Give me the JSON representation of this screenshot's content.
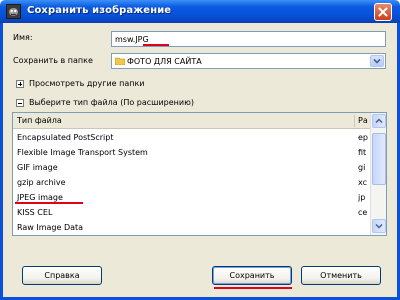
{
  "window": {
    "title": "Сохранить изображение"
  },
  "form": {
    "name_label": "Имя:",
    "name_value": "msw.JPG",
    "folder_label": "Сохранить в папке",
    "folder_value": "ФОТО ДЛЯ САЙТА"
  },
  "expanders": {
    "browse_label": "Просмотреть другие папки",
    "filetype_label": "Выберите тип файла (По расширению)"
  },
  "filetype_list": {
    "columns": [
      "Тип файла",
      "Ра"
    ],
    "rows": [
      {
        "name": "Encapsulated PostScript",
        "ext": "ep"
      },
      {
        "name": "Flexible Image Transport System",
        "ext": "fit"
      },
      {
        "name": "GIF image",
        "ext": "gi"
      },
      {
        "name": "gzip archive",
        "ext": "xc"
      },
      {
        "name": "JPEG image",
        "ext": "jp"
      },
      {
        "name": "KISS CEL",
        "ext": "ce"
      },
      {
        "name": "Raw Image Data",
        "ext": ""
      }
    ]
  },
  "buttons": {
    "help": "Справка",
    "save": "Сохранить",
    "cancel": "Отменить"
  },
  "colors": {
    "titlebar": "#0650d8",
    "dialog_bg": "#ece9d8",
    "highlight_underline": "#e0001a"
  }
}
